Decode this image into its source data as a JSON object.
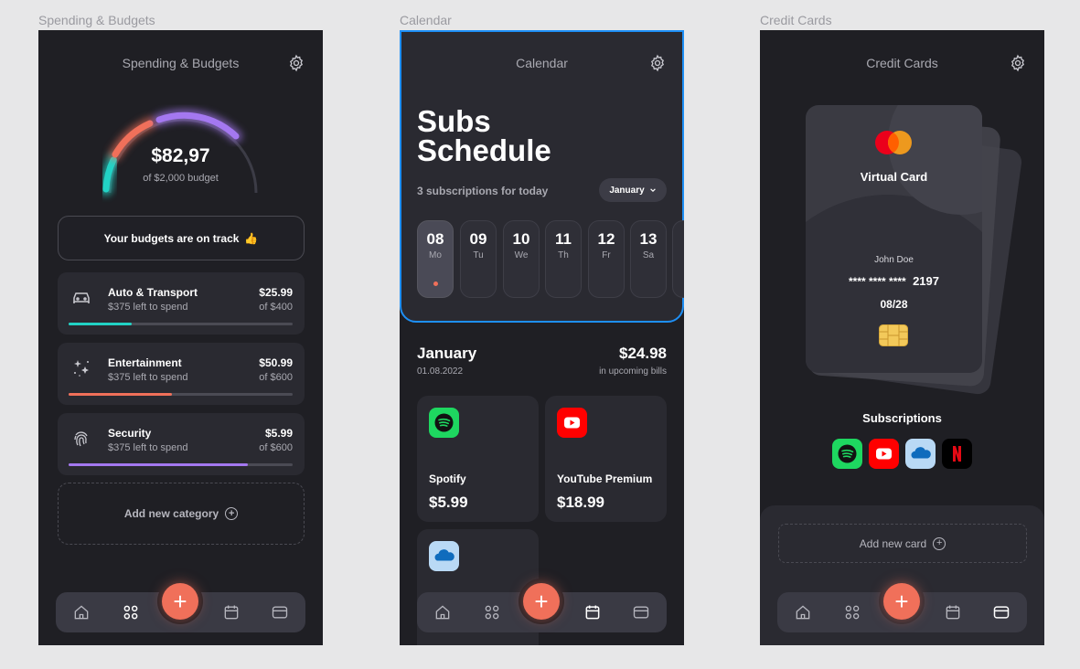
{
  "frames": {
    "spending": "Spending & Budgets",
    "calendar": "Calendar",
    "credit": "Credit Cards"
  },
  "spending": {
    "header_title": "Spending & Budgets",
    "amount": "$82,97",
    "budget_note": "of $2,000 budget",
    "banner": "Your budgets are on track",
    "banner_emoji": "👍",
    "categories": [
      {
        "name": "Auto & Transport",
        "left": "$375 left to spend",
        "amount": "$25.99",
        "of": "of $400",
        "progress": 0.28,
        "color": "#22d3c5",
        "icon": "car-icon"
      },
      {
        "name": "Entertainment",
        "left": "$375 left to spend",
        "amount": "$50.99",
        "of": "of $600",
        "progress": 0.46,
        "color": "#f0705a",
        "icon": "sparkles-icon"
      },
      {
        "name": "Security",
        "left": "$375 left to spend",
        "amount": "$5.99",
        "of": "of $600",
        "progress": 0.8,
        "color": "#a478f0",
        "icon": "fingerprint-icon"
      }
    ],
    "add_category": "Add new category"
  },
  "calendar": {
    "header_title": "Calendar",
    "title_line1": "Subs",
    "title_line2": "Schedule",
    "today": "3 subscriptions for today",
    "month_pill": "January",
    "days": [
      {
        "num": "08",
        "name": "Mo"
      },
      {
        "num": "09",
        "name": "Tu"
      },
      {
        "num": "10",
        "name": "We"
      },
      {
        "num": "11",
        "name": "Th"
      },
      {
        "num": "12",
        "name": "Fr"
      },
      {
        "num": "13",
        "name": "Sa"
      }
    ],
    "month": "January",
    "date": "01.08.2022",
    "total": "$24.98",
    "total_sub": "in upcoming bills",
    "subscriptions": [
      {
        "name": "Spotify",
        "price": "$5.99"
      },
      {
        "name": "YouTube Premium",
        "price": "$18.99"
      }
    ]
  },
  "credit": {
    "header_title": "Credit Cards",
    "card_title": "Virtual Card",
    "holder": "John Doe",
    "masked": "****  ****  ****",
    "last4": "2197",
    "expiry": "08/28",
    "subs_heading": "Subscriptions",
    "add_card": "Add new card"
  },
  "colors": {
    "accent": "#f0705a",
    "selection": "#1e8ff5",
    "teal": "#22d3c5",
    "purple": "#a478f0"
  }
}
